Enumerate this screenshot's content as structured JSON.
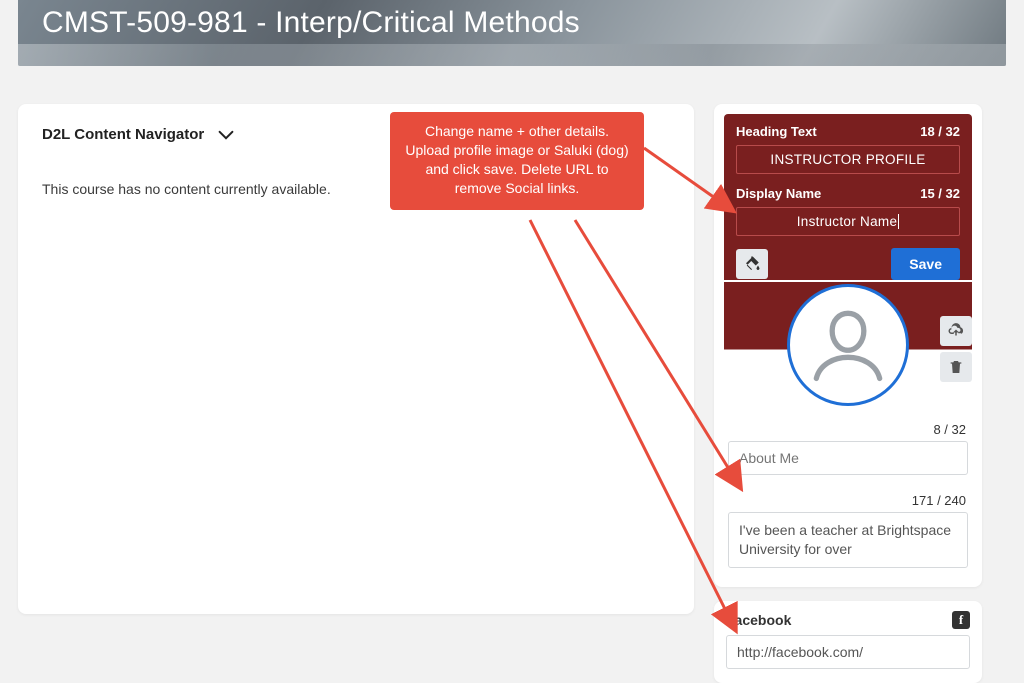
{
  "banner": {
    "title": "CMST-509-981 - Interp/Critical Methods"
  },
  "content": {
    "navigator_label": "D2L Content Navigator",
    "empty_message": "This course has no content currently available."
  },
  "callout": {
    "text": "Change name + other details. Upload profile image or Saluki (dog) and click save. Delete URL to remove Social links."
  },
  "profile": {
    "heading_label": "Heading Text",
    "heading_count": "18 / 32",
    "heading_value": "INSTRUCTOR PROFILE",
    "name_label": "Display Name",
    "name_count": "15 / 32",
    "name_value": "Instructor Name",
    "save_label": "Save",
    "about_count": "8 / 32",
    "about_placeholder": "About Me",
    "bio_count": "171 / 240",
    "bio_value": "I've been a teacher at Brightspace University for over"
  },
  "social": {
    "label": "Facebook",
    "url": "http://facebook.com/"
  }
}
